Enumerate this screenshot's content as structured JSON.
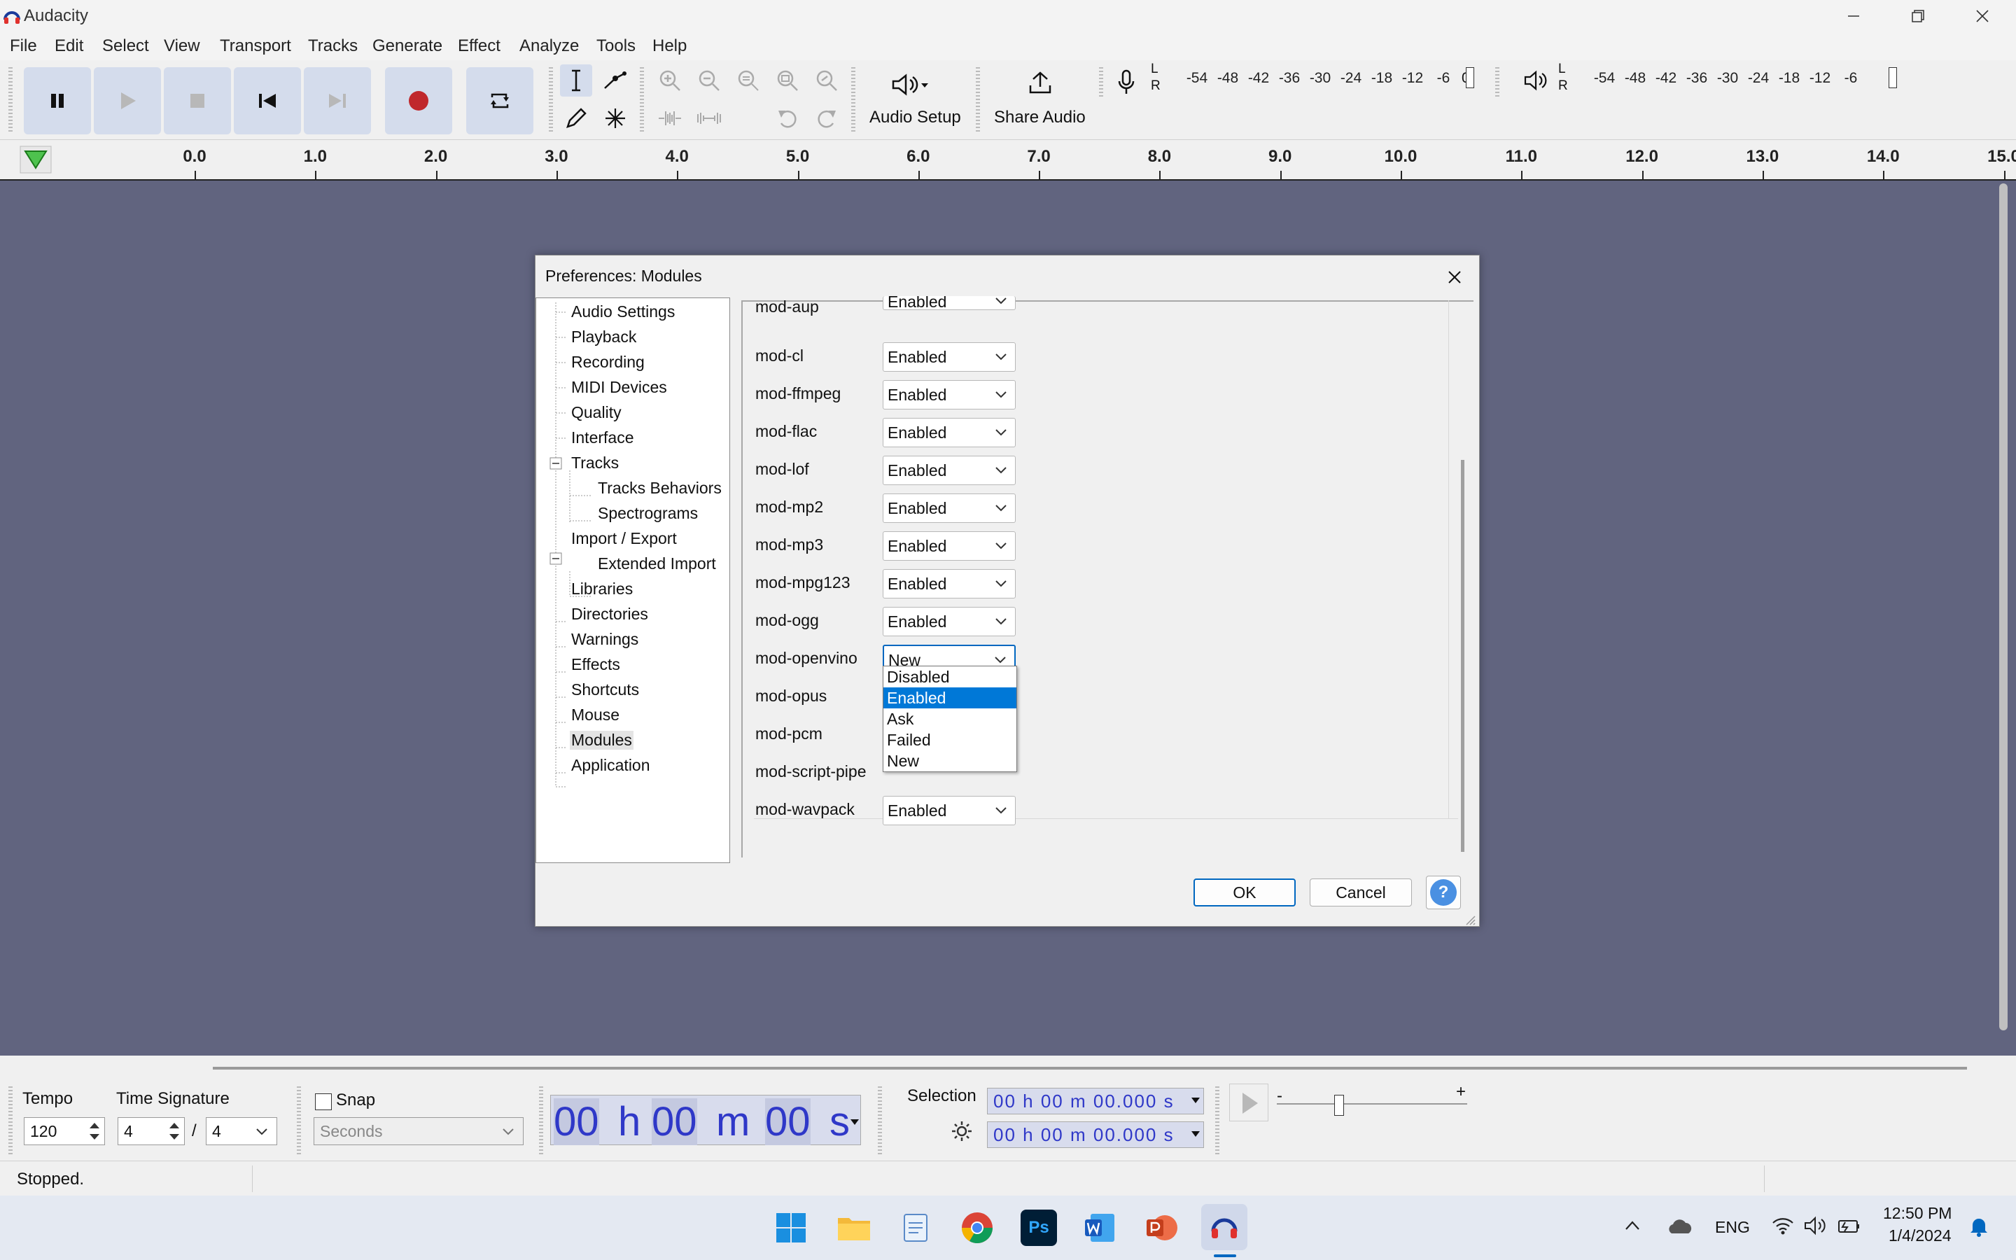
{
  "window": {
    "title": "Audacity"
  },
  "menu": [
    "File",
    "Edit",
    "Select",
    "View",
    "Transport",
    "Tracks",
    "Generate",
    "Effect",
    "Analyze",
    "Tools",
    "Help"
  ],
  "toolbar": {
    "audio_setup_label": "Audio Setup",
    "share_audio_label": "Share Audio",
    "record_meter_ticks": [
      "-54",
      "-48",
      "-42",
      "-36",
      "-30",
      "-24",
      "-18",
      "-12",
      "-6"
    ],
    "play_meter_ticks": [
      "-54",
      "-48",
      "-42",
      "-36",
      "-30",
      "-24",
      "-18",
      "-12",
      "-6"
    ],
    "meter_l": "L",
    "meter_r": "R",
    "record_meter_end": "0",
    "accent_record": "#c0282c"
  },
  "ruler": {
    "labels": [
      "0.0",
      "1.0",
      "2.0",
      "3.0",
      "4.0",
      "5.0",
      "6.0",
      "7.0",
      "8.0",
      "9.0",
      "10.0",
      "11.0",
      "12.0",
      "13.0",
      "14.0",
      "15.0"
    ]
  },
  "dialog": {
    "title": "Preferences: Modules",
    "tree": [
      {
        "label": "Audio Settings",
        "level": 0
      },
      {
        "label": "Playback",
        "level": 0
      },
      {
        "label": "Recording",
        "level": 0
      },
      {
        "label": "MIDI Devices",
        "level": 0
      },
      {
        "label": "Quality",
        "level": 0
      },
      {
        "label": "Interface",
        "level": 0
      },
      {
        "label": "Tracks",
        "level": 0,
        "expanded": true
      },
      {
        "label": "Tracks Behaviors",
        "level": 1
      },
      {
        "label": "Spectrograms",
        "level": 1
      },
      {
        "label": "Import / Export",
        "level": 0,
        "expanded": true
      },
      {
        "label": "Extended Import",
        "level": 1
      },
      {
        "label": "Libraries",
        "level": 0
      },
      {
        "label": "Directories",
        "level": 0
      },
      {
        "label": "Warnings",
        "level": 0
      },
      {
        "label": "Effects",
        "level": 0
      },
      {
        "label": "Shortcuts",
        "level": 0
      },
      {
        "label": "Mouse",
        "level": 0
      },
      {
        "label": "Modules",
        "level": 0,
        "selected": true
      },
      {
        "label": "Application",
        "level": 0
      }
    ],
    "modules": [
      {
        "name": "mod-aup",
        "value": "Enabled"
      },
      {
        "name": "mod-cl",
        "value": "Enabled"
      },
      {
        "name": "mod-ffmpeg",
        "value": "Enabled"
      },
      {
        "name": "mod-flac",
        "value": "Enabled"
      },
      {
        "name": "mod-lof",
        "value": "Enabled"
      },
      {
        "name": "mod-mp2",
        "value": "Enabled"
      },
      {
        "name": "mod-mp3",
        "value": "Enabled"
      },
      {
        "name": "mod-mpg123",
        "value": "Enabled"
      },
      {
        "name": "mod-ogg",
        "value": "Enabled"
      },
      {
        "name": "mod-openvino",
        "value": "New"
      },
      {
        "name": "mod-opus",
        "value": ""
      },
      {
        "name": "mod-pcm",
        "value": ""
      },
      {
        "name": "mod-script-pipe",
        "value": ""
      },
      {
        "name": "mod-wavpack",
        "value": "Enabled"
      }
    ],
    "dropdown_options": [
      "Disabled",
      "Enabled",
      "Ask",
      "Failed",
      "New"
    ],
    "dropdown_highlighted": "Enabled",
    "ok_label": "OK",
    "cancel_label": "Cancel",
    "help_label": "?"
  },
  "bottom": {
    "tempo_label": "Tempo",
    "tempo_value": "120",
    "time_signature_label": "Time Signature",
    "ts_numerator": "4",
    "ts_slash": "/",
    "ts_denominator": "4",
    "snap_label": "Snap",
    "snap_unit": "Seconds",
    "time_h": "00",
    "time_h_unit": "h",
    "time_m": "00",
    "time_m_unit": "m",
    "time_s": "00",
    "time_s_unit": "s",
    "selection_label": "Selection",
    "selection_start": "00 h 00 m 00.000 s",
    "selection_end": "00 h 00 m 00.000 s",
    "speed_minus": "-",
    "speed_plus": "+"
  },
  "status": {
    "text": "Stopped."
  },
  "taskbar": {
    "language": "ENG",
    "time": "12:50 PM",
    "date": "1/4/2024",
    "ps_label": "Ps"
  }
}
